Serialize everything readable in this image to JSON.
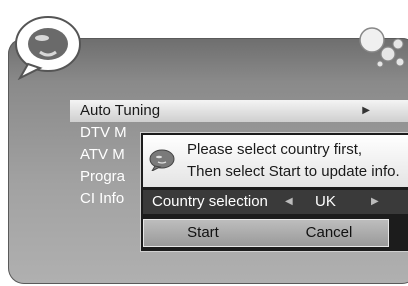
{
  "menu": {
    "items": [
      {
        "label": "Auto Tuning",
        "selected": true
      },
      {
        "label": "DTV M",
        "selected": false
      },
      {
        "label": "ATV M",
        "selected": false
      },
      {
        "label": "Progra",
        "selected": false
      },
      {
        "label": "CI Info",
        "selected": false
      }
    ],
    "arrow_icon": "right-triangle-icon"
  },
  "dialog": {
    "message_line1": "Please select country first,",
    "message_line2": "Then select Start to update info.",
    "message_icon": "speech-bubble-icon",
    "country_label": "Country selection",
    "country_value": "UK",
    "arrow_left_icon": "left-triangle-icon",
    "arrow_right_icon": "right-triangle-icon",
    "start_label": "Start",
    "cancel_label": "Cancel"
  },
  "colors": {
    "panel_gradient_top": "#6e6e6e",
    "panel_gradient_bottom": "#b0b0b0",
    "selected_row": "#e0e0e0",
    "dialog_background": "#1c1c1c",
    "country_row": "#3a3a3a",
    "button_row": "#aaaaaa"
  }
}
